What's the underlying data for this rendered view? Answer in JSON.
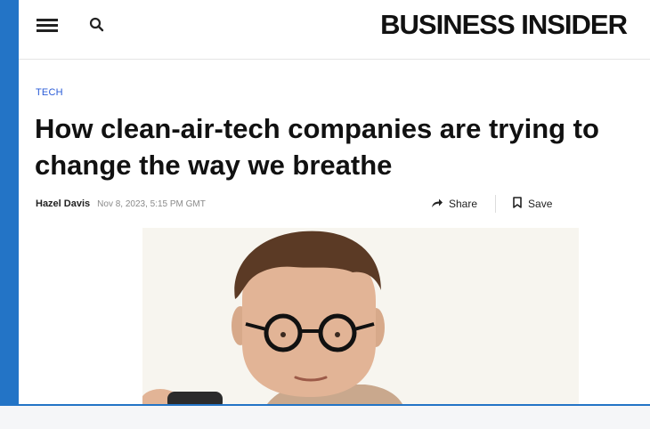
{
  "header": {
    "menu_icon": "menu-icon",
    "search_icon": "search-icon",
    "brand": "BUSINESS INSIDER"
  },
  "article": {
    "category": "TECH",
    "headline": "How clean-air-tech companies are trying to change the way we breathe",
    "author": "Hazel Davis",
    "date": "Nov 8, 2023, 5:15 PM GMT",
    "share_label": "Share",
    "save_label": "Save"
  },
  "colors": {
    "accent_blue": "#2374c6",
    "category_blue": "#2a5bd7"
  }
}
